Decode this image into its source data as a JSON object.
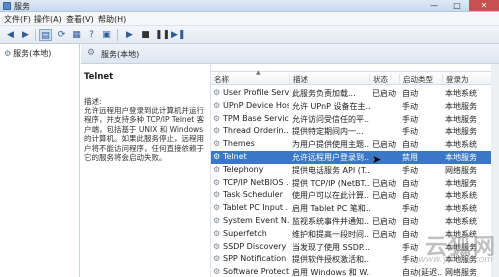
{
  "window": {
    "title": "服务",
    "minimize": "—",
    "maximize": "□",
    "close": "✕"
  },
  "menu": {
    "items": [
      "文件(F)",
      "操作(A)",
      "查看(V)",
      "帮助(H)"
    ]
  },
  "toolbar": {
    "back": "◀",
    "forward": "▶",
    "show_tree": "▤",
    "refresh": "⟳",
    "export": "▦",
    "help": "?",
    "properties": "▣",
    "start": "▶",
    "stop": "■",
    "pause": "❚❚",
    "restart": "▶❚"
  },
  "tree": {
    "root": "服务(本地)"
  },
  "header": {
    "title": "服务(本地)"
  },
  "details": {
    "service_name": "Telnet",
    "description_label": "描述:",
    "description": "允许远程用户登录到此计算机并运行程序，并支持多种 TCP/IP Telnet 客户端，包括基于 UNIX 和 Windows 的计算机。如果此服务停止，远程用户将不能访问程序，任何直接依赖于它的服务将会启动失败。"
  },
  "columns": {
    "name": "名称",
    "description": "描述",
    "status": "状态",
    "startup": "启动类型",
    "logon": "登录为"
  },
  "services": [
    {
      "name": "User Profile Serv...",
      "description": "此服务负责加载...",
      "status": "已启动",
      "startup": "自动",
      "logon": "本地系统"
    },
    {
      "name": "UPnP Device Host",
      "description": "允许 UPnP 设备在主...",
      "status": "",
      "startup": "手动",
      "logon": "本地服务"
    },
    {
      "name": "TPM Base Servic...",
      "description": "允许访问受信任的平...",
      "status": "",
      "startup": "手动",
      "logon": "本地服务"
    },
    {
      "name": "Thread Orderin...",
      "description": "提供特定期间内一...",
      "status": "",
      "startup": "手动",
      "logon": "本地服务"
    },
    {
      "name": "Themes",
      "description": "为用户提供使用主题...",
      "status": "已启动",
      "startup": "自动",
      "logon": "本地系统"
    },
    {
      "name": "Telnet",
      "description": "允许远程用户登录到...",
      "status": "",
      "startup": "禁用",
      "logon": "本地服务"
    },
    {
      "name": "Telephony",
      "description": "提供电话服务 API (T...",
      "status": "",
      "startup": "手动",
      "logon": "网络服务"
    },
    {
      "name": "TCP/IP NetBIOS ...",
      "description": "提供 TCP/IP (NetBT...",
      "status": "已启动",
      "startup": "自动",
      "logon": "本地服务"
    },
    {
      "name": "Task Scheduler",
      "description": "使用户可以在此计算...",
      "status": "已启动",
      "startup": "自动",
      "logon": "本地系统"
    },
    {
      "name": "Tablet PC Input ...",
      "description": "启用 Tablet PC 笔和...",
      "status": "",
      "startup": "手动",
      "logon": "本地系统"
    },
    {
      "name": "System Event N...",
      "description": "监视系统事件并通知...",
      "status": "已启动",
      "startup": "自动",
      "logon": "本地系统"
    },
    {
      "name": "Superfetch",
      "description": "维护和提高一段时间...",
      "status": "已启动",
      "startup": "自动",
      "logon": "本地系统"
    },
    {
      "name": "SSDP Discovery",
      "description": "当发现了使用 SSDP...",
      "status": "",
      "startup": "手动",
      "logon": "本地服务"
    },
    {
      "name": "SPP Notification ...",
      "description": "提供软件授权激活和...",
      "status": "",
      "startup": "手动",
      "logon": "本地服务"
    },
    {
      "name": "Software Protect...",
      "description": "启用 Windows 和 W...",
      "status": "",
      "startup": "自动(延迟...",
      "logon": "网络服务"
    }
  ],
  "selected_service": "Telnet",
  "watermark": {
    "main": "云狐网",
    "sub": "www.yunhu.com"
  },
  "colors": {
    "selection": "#3a78c7",
    "header_gradient": "#dde6f1"
  }
}
